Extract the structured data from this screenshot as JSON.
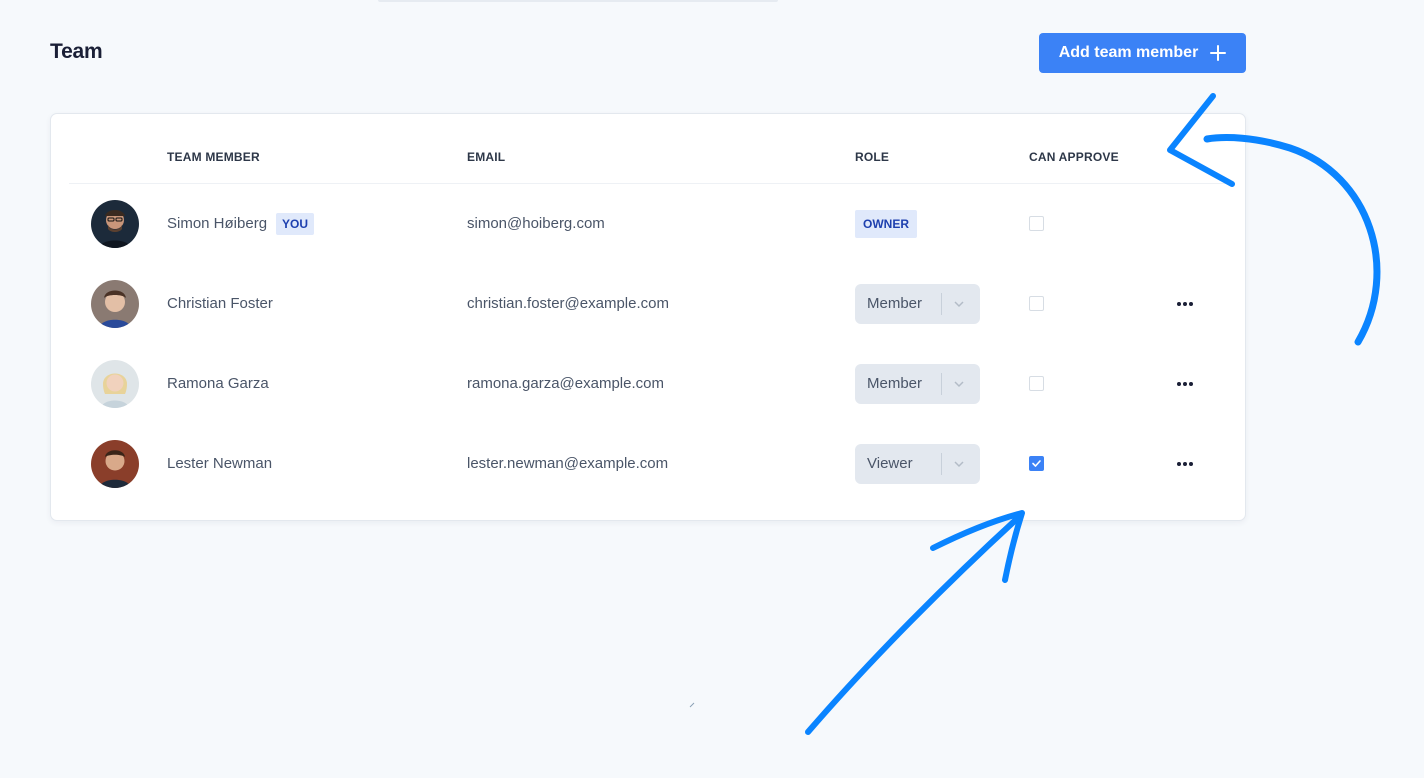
{
  "page": {
    "title": "Team"
  },
  "header": {
    "add_button_label": "Add team member",
    "add_icon": "plus-icon"
  },
  "table": {
    "columns": [
      "TEAM MEMBER",
      "EMAIL",
      "ROLE",
      "CAN APPROVE"
    ],
    "rows": [
      {
        "name": "Simon Høiberg",
        "badge": "YOU",
        "email": "simon@hoiberg.com",
        "role": "OWNER",
        "role_editable": false,
        "can_approve": false,
        "has_menu": false
      },
      {
        "name": "Christian Foster",
        "badge": "",
        "email": "christian.foster@example.com",
        "role": "Member",
        "role_editable": true,
        "can_approve": false,
        "has_menu": true
      },
      {
        "name": "Ramona Garza",
        "badge": "",
        "email": "ramona.garza@example.com",
        "role": "Member",
        "role_editable": true,
        "can_approve": false,
        "has_menu": true
      },
      {
        "name": "Lester Newman",
        "badge": "",
        "email": "lester.newman@example.com",
        "role": "Viewer",
        "role_editable": true,
        "can_approve": true,
        "has_menu": true
      }
    ]
  },
  "colors": {
    "accent": "#3b82f6",
    "badge_bg": "#e0e9fb",
    "badge_text": "#1e40af",
    "annotation_arrow": "#0a84ff"
  }
}
